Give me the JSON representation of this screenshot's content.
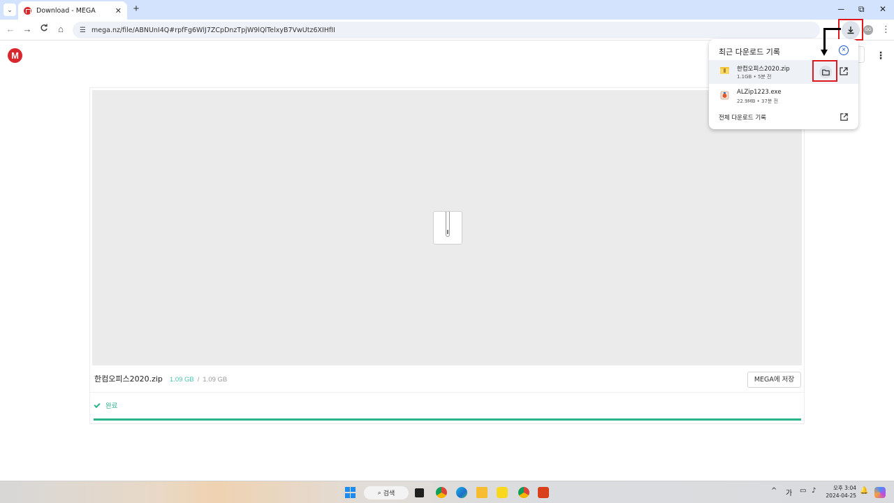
{
  "browser": {
    "tab_title": "Download - MEGA",
    "tab_close": "✕",
    "new_tab": "+",
    "tab_list": "⌄",
    "url": "mega.nz/file/ABNUnI4Q#rpfFg6WlJ7ZCpDnzTpjW9lQlTelxyB7VwUtz6XIHfII",
    "window_controls": {
      "minimize": "─",
      "maximize": "⧉",
      "close": "✕"
    },
    "nav": {
      "back": "←",
      "forward": "→",
      "reload": "C",
      "home": "⌂"
    },
    "profile_initials": "GG",
    "menu": "⋮"
  },
  "mega": {
    "logo_letter": "M",
    "menu": "⋮",
    "file_name": "한컴오피스2020.zip",
    "downloaded": "1.09 GB",
    "separator": "/",
    "total_size": "1.09 GB",
    "save_button": "MEGA에 저장",
    "status_label": "완료",
    "progress_percent": 100,
    "colors": {
      "accent": "#2bb38c",
      "brand": "#d9272e"
    }
  },
  "download_bubble": {
    "title": "최근 다운로드 기록",
    "items": [
      {
        "name": "한컴오피스2020.zip",
        "meta": "1.1GB • 5분 전",
        "icon": "folder-zip-icon"
      },
      {
        "name": "ALZip1223.exe",
        "meta": "22.9MB • 37분 전",
        "icon": "installer-icon"
      }
    ],
    "all_downloads": "전체 다운로드 기록"
  },
  "taskbar": {
    "search_label": "검색",
    "tray_caret": "^",
    "ime": "가",
    "time": "오후 3:04",
    "date": "2024-04-25"
  }
}
